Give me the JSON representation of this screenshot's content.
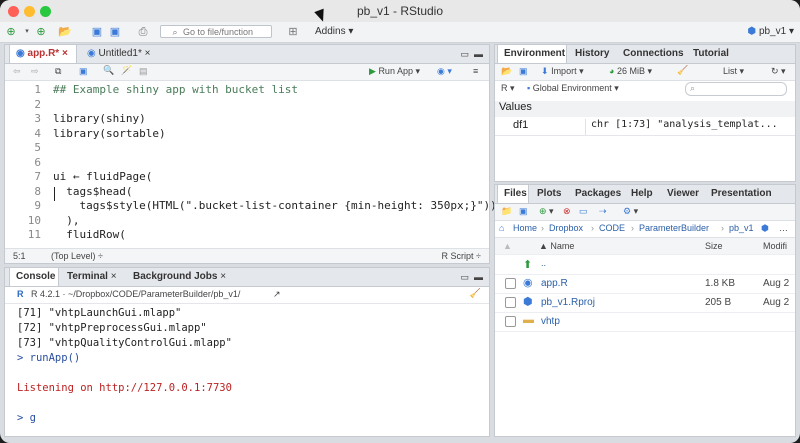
{
  "window": {
    "title": "pb_v1 - RStudio"
  },
  "toolbar": {
    "goto_placeholder": "Go to file/function",
    "addins_label": "Addins",
    "project_label": "pb_v1"
  },
  "source": {
    "tabs": [
      {
        "label": "app.R*"
      },
      {
        "label": "Untitled1*"
      }
    ],
    "run_label": "Run App",
    "lines": [
      {
        "num": "1",
        "text": "## Example shiny app with bucket list"
      },
      {
        "num": "2",
        "text": ""
      },
      {
        "num": "3",
        "text": "library(shiny)"
      },
      {
        "num": "4",
        "text": "library(sortable)"
      },
      {
        "num": "5",
        "text": ""
      },
      {
        "num": "6",
        "text": ""
      },
      {
        "num": "7",
        "text": "ui ← fluidPage("
      },
      {
        "num": "8",
        "text": "  tags$head("
      },
      {
        "num": "9",
        "text": "    tags$style(HTML(\".bucket-list-container {min-height: 350px;}\"))"
      },
      {
        "num": "10",
        "text": "  ),"
      },
      {
        "num": "11",
        "text": "  fluidRow("
      }
    ],
    "status_position": "5:1",
    "status_scope": "(Top Level) ÷",
    "status_type": "R Script ÷"
  },
  "console": {
    "tabs": [
      {
        "label": "Console"
      },
      {
        "label": "Terminal"
      },
      {
        "label": "Background Jobs"
      }
    ],
    "path": "R 4.2.1 · ~/Dropbox/CODE/ParameterBuilder/pb_v1/",
    "lines": [
      "[71] \"vhtpLaunchGui.mlapp\"",
      "[72] \"vhtpPreprocessGui.mlapp\"",
      "[73] \"vhtpQualityControlGui.mlapp\"",
      "> runApp()",
      "",
      "Listening on http://127.0.0.1:7730",
      "",
      "> g"
    ]
  },
  "environment": {
    "tabs": [
      {
        "label": "Environment"
      },
      {
        "label": "History"
      },
      {
        "label": "Connections"
      },
      {
        "label": "Tutorial"
      }
    ],
    "import_label": "Import",
    "memory_label": "26 MiB",
    "list_label": "List",
    "lang_label": "R",
    "scope_label": "Global Environment",
    "section_label": "Values",
    "values": [
      {
        "name": "df1",
        "value": "chr [1:73] \"analysis_templat..."
      }
    ]
  },
  "files": {
    "tabs": [
      {
        "label": "Files"
      },
      {
        "label": "Plots"
      },
      {
        "label": "Packages"
      },
      {
        "label": "Help"
      },
      {
        "label": "Viewer"
      },
      {
        "label": "Presentation"
      }
    ],
    "breadcrumb": [
      "Home",
      "Dropbox",
      "CODE",
      "ParameterBuilder",
      "pb_v1"
    ],
    "columns": {
      "name": "▲ Name",
      "size": "Size",
      "modified": "Modifi"
    },
    "parent_label": "..",
    "rows": [
      {
        "name": "app.R",
        "size": "1.8 KB",
        "modified": "Aug 2"
      },
      {
        "name": "pb_v1.Rproj",
        "size": "205 B",
        "modified": "Aug 2"
      },
      {
        "name": "vhtp",
        "size": "",
        "modified": ""
      }
    ]
  },
  "colors": {
    "red_light": "#ff5f57",
    "yellow_light": "#febc2e",
    "green_light": "#28c840",
    "accent": "#3b7ad6"
  }
}
